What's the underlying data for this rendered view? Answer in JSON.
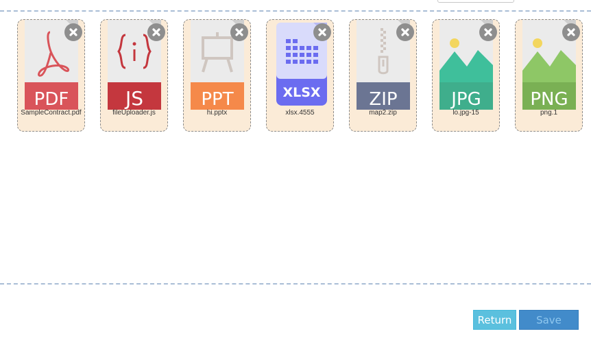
{
  "colors": {
    "card_bg": "#fbebd7",
    "card_border": "#8c8c8c",
    "dash_line": "#a9bdd6",
    "remove_bg": "#8e8e8e",
    "return_bg": "#5bc0de",
    "save_bg": "#428bca"
  },
  "files": [
    {
      "name": "SampleContract.pdf",
      "badge": "PDF",
      "color": "#d9545a",
      "icon": "pdf-file-icon"
    },
    {
      "name": "fileUploader.js",
      "badge": "JS",
      "color": "#c4373e",
      "icon": "js-file-icon"
    },
    {
      "name": "hi.pptx",
      "badge": "PPT",
      "color": "#f5894a",
      "icon": "ppt-file-icon"
    },
    {
      "name": "xlsx.4555",
      "badge": "XLSX",
      "color": "#6b6cf0",
      "icon": "xlsx-file-icon"
    },
    {
      "name": "map2.zip",
      "badge": "ZIP",
      "color": "#6b7593",
      "icon": "zip-file-icon"
    },
    {
      "name": "lo.jpg-15",
      "badge": "JPG",
      "color": "#3fae8c",
      "icon": "jpg-file-icon"
    },
    {
      "name": "png.1",
      "badge": "PNG",
      "color": "#7ab054",
      "icon": "png-file-icon"
    }
  ],
  "remove_icon": "close-icon",
  "buttons": {
    "return_label": "Return",
    "save_label": "Save"
  }
}
